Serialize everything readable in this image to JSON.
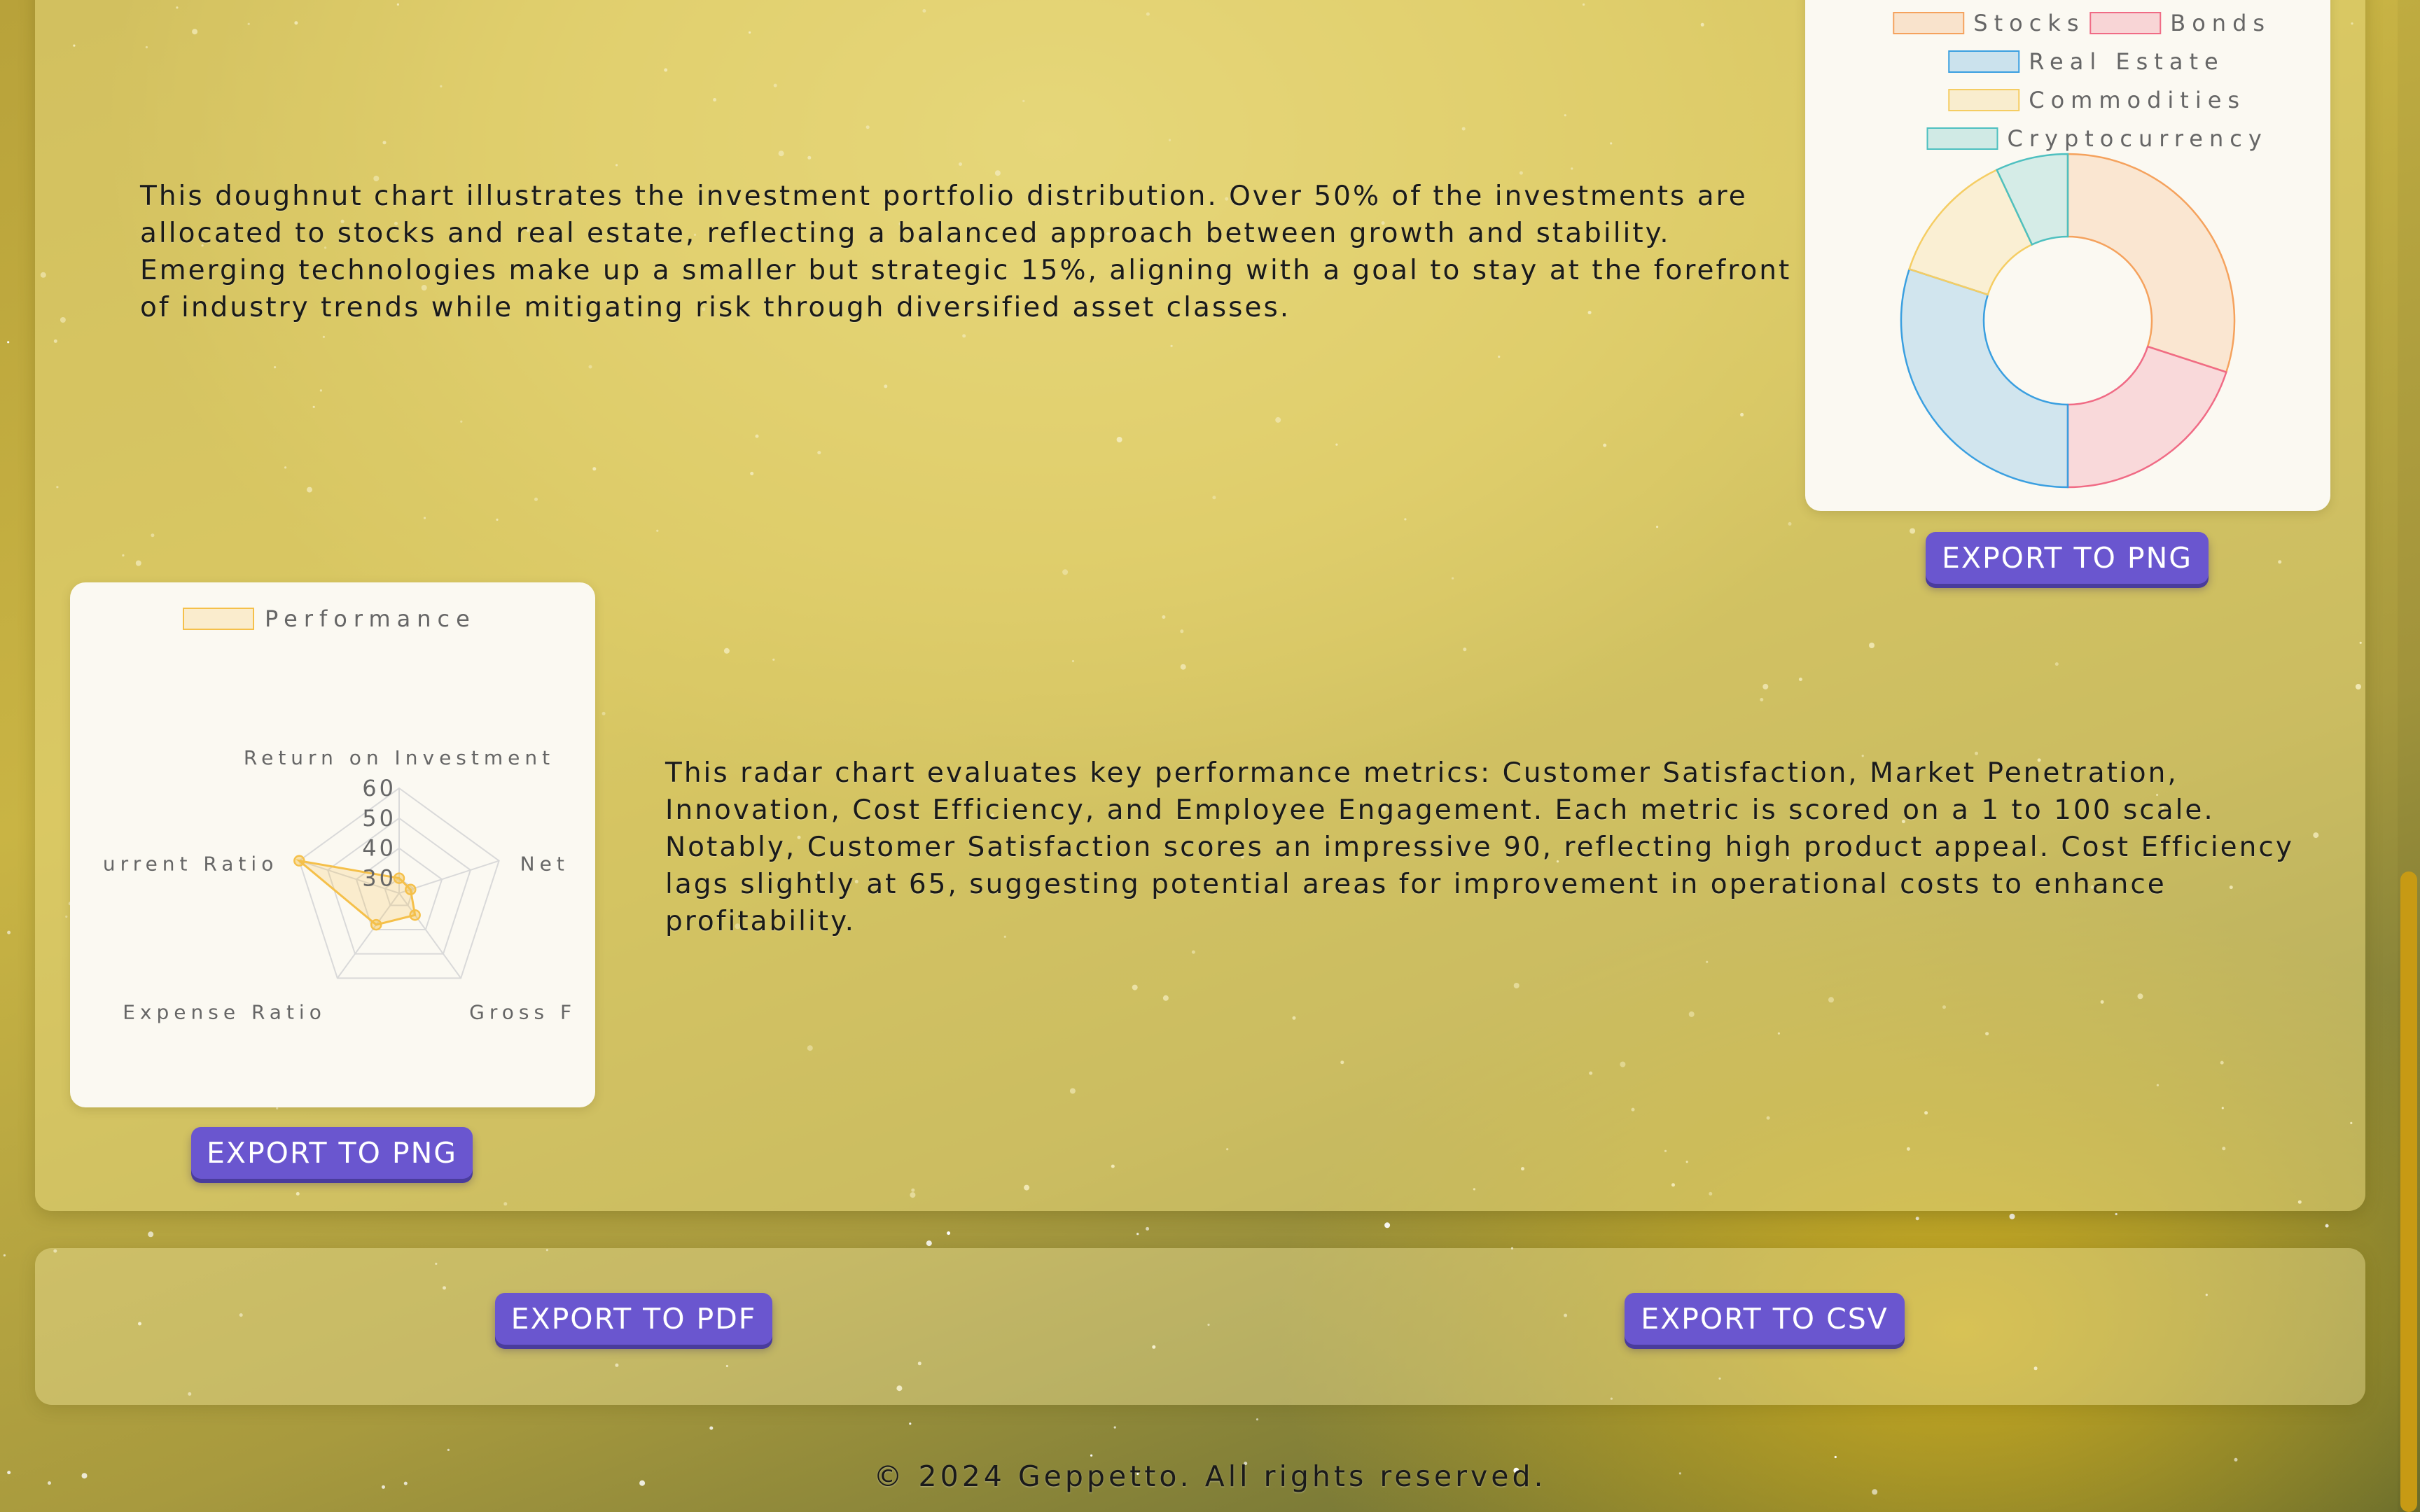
{
  "doughnut_section": {
    "description": "This doughnut chart illustrates the investment portfolio distribution. Over 50% of the investments are allocated to stocks and real estate, reflecting a balanced approach between growth and stability. Emerging technologies make up a smaller but strategic 15%, aligning with a goal to stay at the forefront of industry trends while mitigating risk through diversified asset classes.",
    "export_label": "EXPORT TO PNG"
  },
  "radar_section": {
    "description": "This radar chart evaluates key performance metrics: Customer Satisfaction, Market Penetration, Innovation, Cost Efficiency, and Employee Engagement. Each metric is scored on a 1 to 100 scale. Notably, Customer Satisfaction scores an impressive 90, reflecting high product appeal. Cost Efficiency lags slightly at 65, suggesting potential areas for improvement in operational costs to enhance profitability.",
    "export_label": "EXPORT TO PNG"
  },
  "toolbar": {
    "export_pdf_label": "EXPORT TO PDF",
    "export_csv_label": "EXPORT TO CSV"
  },
  "footer": {
    "text": "© 2024 Geppetto. All rights reserved."
  },
  "colors": {
    "button": "#6a56cf",
    "stocks": "#f5a25d",
    "bonds": "#f06b85",
    "real_estate": "#3a9fe0",
    "commodities": "#f5cd63",
    "cryptocurrency": "#4ec0c0",
    "performance": "#f5c04a"
  },
  "chart_data": [
    {
      "type": "pie",
      "variant": "doughnut",
      "legend_position": "top",
      "categories": [
        "Stocks",
        "Bonds",
        "Real Estate",
        "Commodities",
        "Cryptocurrency"
      ],
      "values": [
        30,
        20,
        30,
        13,
        7
      ],
      "colors": [
        "#f5a25d",
        "#f06b85",
        "#3a9fe0",
        "#f5cd63",
        "#4ec0c0"
      ]
    },
    {
      "type": "radar",
      "legend_position": "top",
      "categories": [
        "Return on Investment",
        "Net",
        "Gross F",
        "Expense Ratio",
        "urrent Ratio"
      ],
      "series": [
        {
          "name": "Performance",
          "values": [
            30,
            29,
            34,
            38,
            60
          ]
        }
      ],
      "ylim": [
        25,
        60
      ],
      "ticks": [
        30,
        40,
        50,
        60
      ],
      "tick_labels": [
        "30",
        "40",
        "50",
        "60"
      ]
    }
  ]
}
